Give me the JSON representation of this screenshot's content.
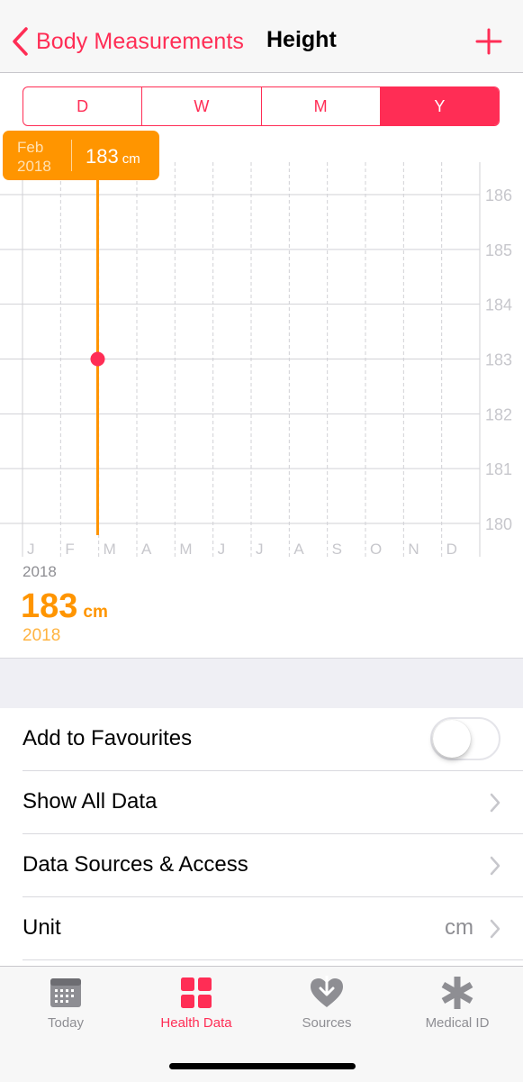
{
  "nav": {
    "back_label": "Body Measurements",
    "title": "Height"
  },
  "segments": [
    {
      "label": "D",
      "active": false
    },
    {
      "label": "W",
      "active": false
    },
    {
      "label": "M",
      "active": false
    },
    {
      "label": "Y",
      "active": true
    }
  ],
  "tooltip": {
    "month": "Feb",
    "year": "2018",
    "value": "183",
    "unit": "cm"
  },
  "chart_data": {
    "type": "scatter",
    "x_labels": [
      "J",
      "F",
      "M",
      "A",
      "M",
      "J",
      "J",
      "A",
      "S",
      "O",
      "N",
      "D"
    ],
    "y_ticks": [
      186,
      185,
      184,
      183,
      182,
      181,
      180
    ],
    "ylim": [
      180,
      186
    ],
    "points": [
      {
        "month": "F",
        "value": 183
      }
    ],
    "selected_month": "F",
    "year_label": "2018",
    "colors": {
      "point": "#ff2d55",
      "selection": "#ff9500",
      "grid": "#d1d1d6",
      "axis_text": "#c7c7cc"
    }
  },
  "summary": {
    "value": "183",
    "unit": "cm",
    "year": "2018"
  },
  "rows": {
    "favourites": "Add to Favourites",
    "favourites_on": false,
    "show_all": "Show All Data",
    "sources": "Data Sources & Access",
    "unit": "Unit",
    "unit_value": "cm"
  },
  "tabs": [
    {
      "label": "Today",
      "icon": "calendar-icon",
      "active": false
    },
    {
      "label": "Health Data",
      "icon": "grid-icon",
      "active": true
    },
    {
      "label": "Sources",
      "icon": "heart-arrow-icon",
      "active": false
    },
    {
      "label": "Medical ID",
      "icon": "asterisk-icon",
      "active": false
    }
  ],
  "colors": {
    "accent": "#ff2d55",
    "orange": "#ff9500",
    "gray": "#8e8e93"
  }
}
